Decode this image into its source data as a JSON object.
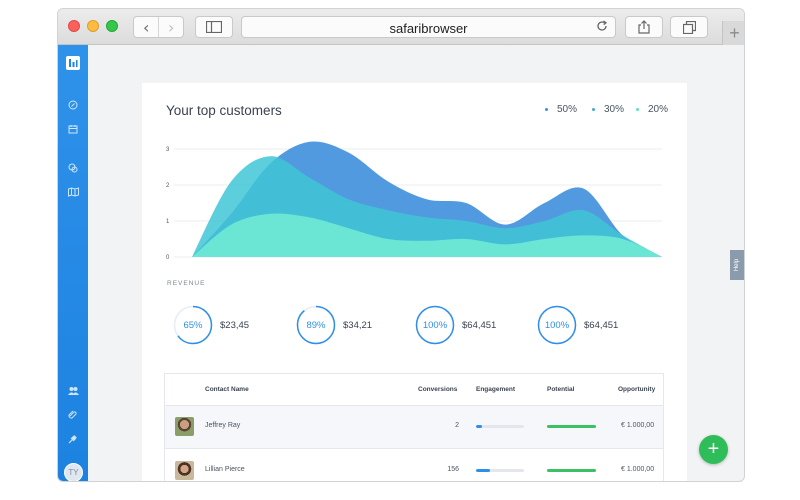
{
  "browser": {
    "url": "safaribrowser",
    "icons": [
      "back-icon",
      "forward-icon",
      "sidebar-icon",
      "reload-icon",
      "share-icon",
      "tabs-icon",
      "plus-icon"
    ]
  },
  "sidenav": {
    "icons": [
      "dashboard-logo-icon",
      "compass-icon",
      "calendar-icon",
      "chat-icon",
      "map-icon",
      "users-icon",
      "paperclip-icon",
      "plug-icon"
    ],
    "avatar_initials": "TY",
    "color": "#1f86e3"
  },
  "card": {
    "title": "Your top customers",
    "revenue_label": "REVENUE"
  },
  "legend": [
    {
      "label": "50%",
      "color": "#3f8fdc"
    },
    {
      "label": "30%",
      "color": "#3fa9d8"
    },
    {
      "label": "20%",
      "color": "#5ee0cc"
    }
  ],
  "chart_data": {
    "type": "area",
    "y_ticks": [
      "3",
      "2",
      "1",
      "0"
    ],
    "ylim": [
      0,
      3
    ],
    "x": [
      0,
      1,
      2,
      3,
      4,
      5,
      6,
      7,
      8,
      9,
      10,
      11,
      12
    ],
    "series": [
      {
        "color": "#3f8fdc",
        "values": [
          0,
          1.2,
          2.6,
          3.2,
          2.9,
          2.1,
          1.6,
          1.5,
          0.9,
          1.5,
          1.9,
          0.6,
          0
        ]
      },
      {
        "color": "#3fc6d6",
        "values": [
          0,
          2.1,
          2.8,
          2.2,
          1.6,
          1.3,
          1.1,
          1.0,
          0.8,
          1.0,
          1.3,
          0.6,
          0
        ]
      },
      {
        "color": "#6fe8d4",
        "values": [
          0,
          0.9,
          1.2,
          1.1,
          0.8,
          0.5,
          0.45,
          0.5,
          0.35,
          0.5,
          0.6,
          0.5,
          0
        ]
      }
    ],
    "grid": true
  },
  "kpis": [
    {
      "percent": "65%",
      "fraction": 0.65,
      "value": "$23,45"
    },
    {
      "percent": "89%",
      "fraction": 0.89,
      "value": "$34,21"
    },
    {
      "percent": "100%",
      "fraction": 1.0,
      "value": "$64,451"
    },
    {
      "percent": "100%",
      "fraction": 1.0,
      "value": "$64,451"
    }
  ],
  "table": {
    "columns": [
      "Contact Name",
      "Conversions",
      "Engagement",
      "Potential",
      "Opportunity"
    ],
    "rows": [
      {
        "name": "Jeffrey Ray",
        "conversions": "2",
        "engagement": 0.12,
        "potential": 1.0,
        "opportunity": "€ 1.000,00"
      },
      {
        "name": "Lillian Pierce",
        "conversions": "156",
        "engagement": 0.3,
        "potential": 1.0,
        "opportunity": "€ 1.000,00"
      }
    ]
  },
  "help_tab": "Help",
  "fab_icon": "plus-icon"
}
